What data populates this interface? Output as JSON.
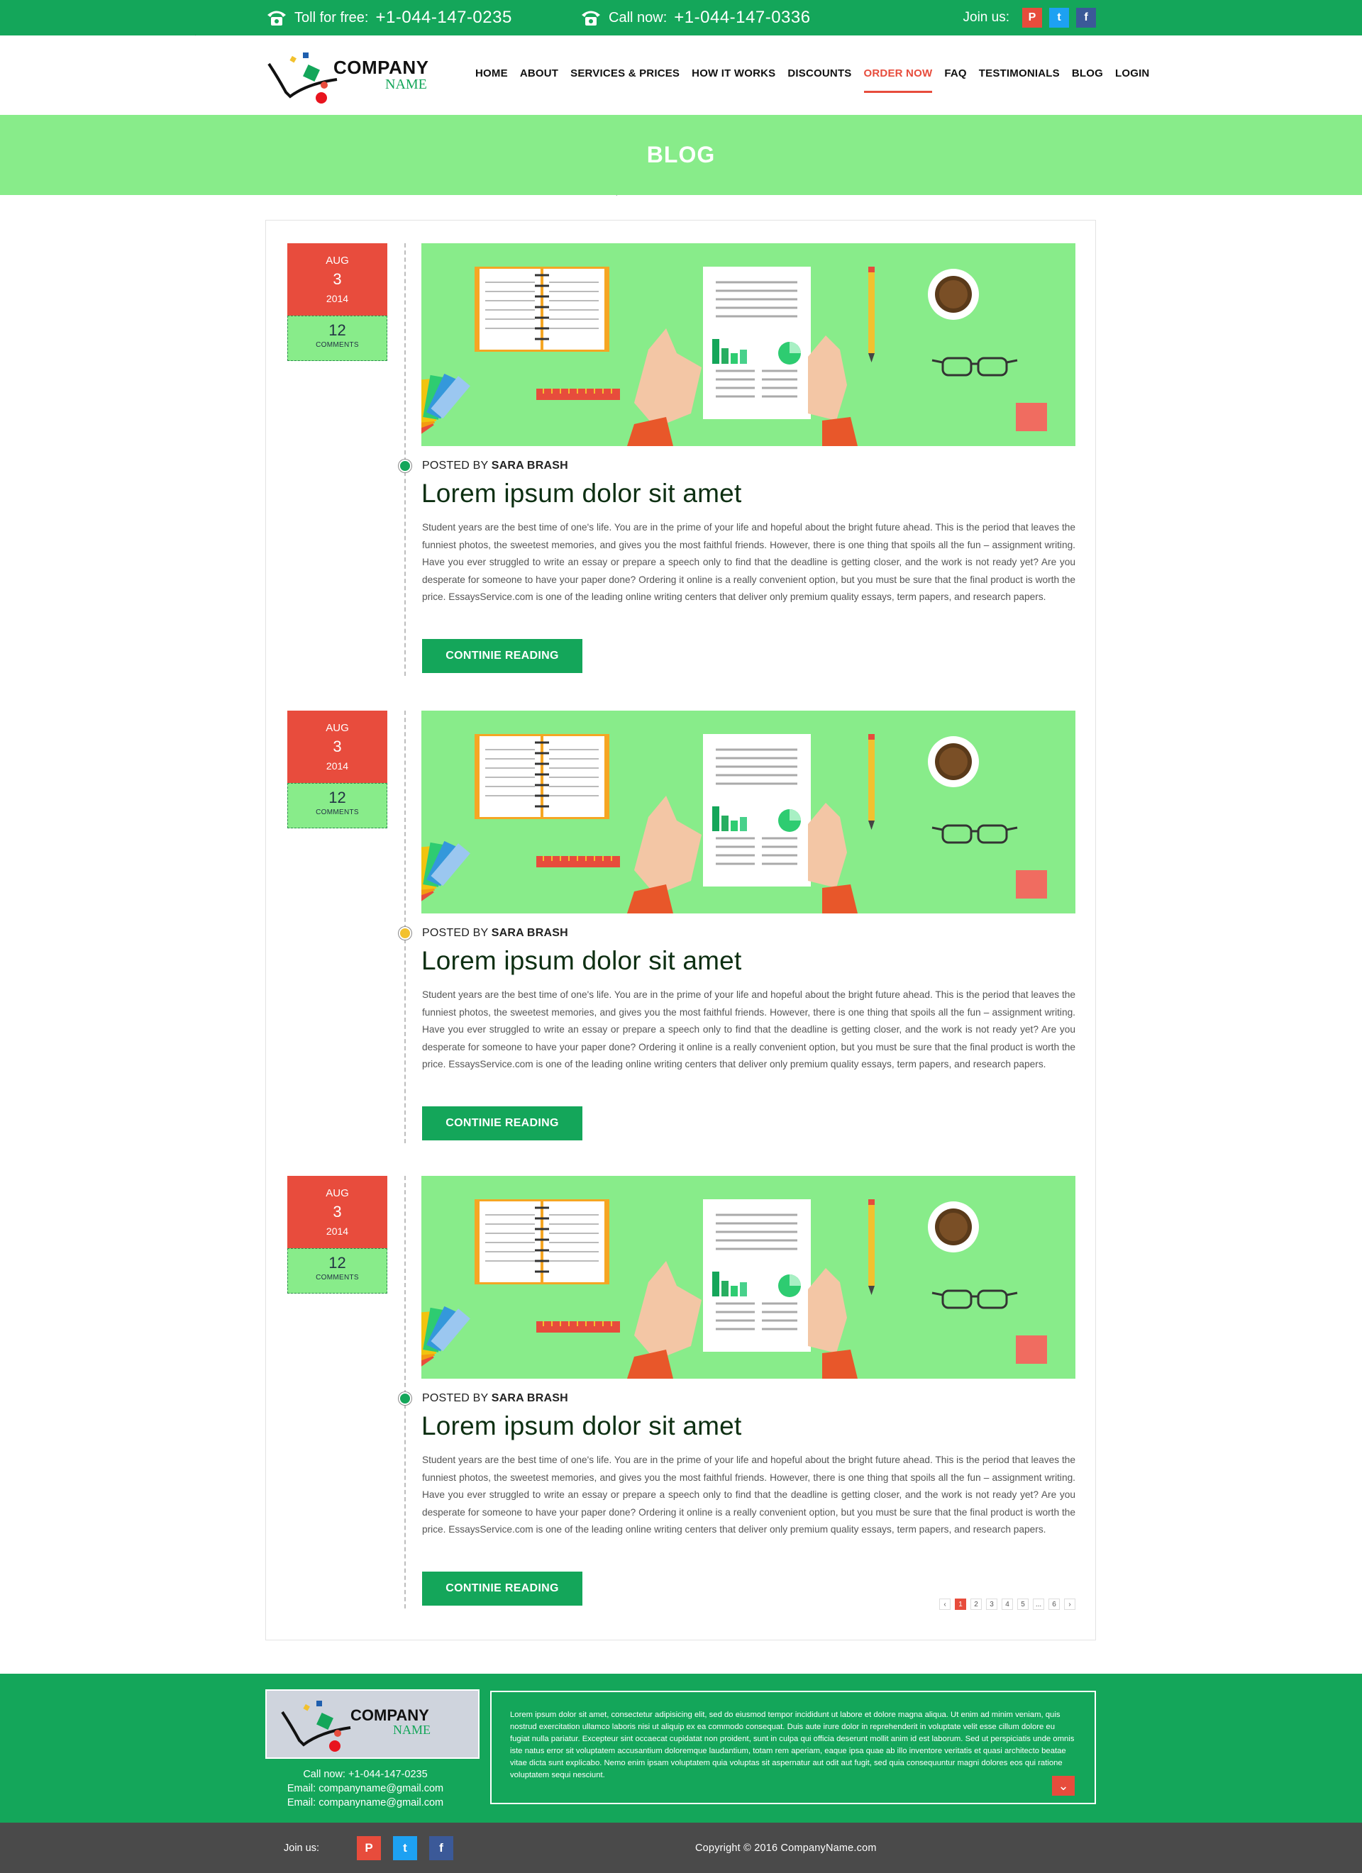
{
  "topbar": {
    "toll_label": "Toll for free:",
    "toll_number": "+1-044-147-0235",
    "call_label": "Call now:",
    "call_number": "+1-044-147-0336",
    "join_label": "Join us:",
    "social": [
      "pinterest-icon",
      "twitter-icon",
      "facebook-icon"
    ]
  },
  "logo": {
    "line1": "COMPANY",
    "line2": "NAME"
  },
  "nav": [
    "HOME",
    "ABOUT",
    "SERVICES & PRICES",
    "HOW IT WORKS",
    "DISCOUNTS",
    "ORDER NOW",
    "FAQ",
    "TESTIMONIALS",
    "BLOG",
    "LOGIN"
  ],
  "nav_active": "ORDER NOW",
  "banner": {
    "title": "BLOG"
  },
  "posts": [
    {
      "month": "AUG",
      "day": "3",
      "year": "2014",
      "comments": "12",
      "comments_label": "COMMENTS",
      "posted_by": "POSTED BY",
      "author": "SARA BRASH",
      "title": "Lorem ipsum dolor sit amet",
      "body": "Student years are the best time of one's life. You are in the prime of your life and hopeful about the bright future ahead. This is the period that leaves the funniest photos, the sweetest memories, and gives you the most faithful friends. However, there is one thing that spoils all the fun – assignment writing. Have you ever struggled to write an essay or prepare a speech only to find that the deadline is getting closer, and the work is not ready yet? Are you desperate for someone to have your paper done? Ordering it online is a really convenient option, but you must be sure that the final product is worth the price. EssaysService.com is one of the leading online writing centers that deliver only premium quality essays, term papers, and research papers.",
      "button": "CONTINIE READING",
      "dot_color": "#14a65a"
    },
    {
      "month": "AUG",
      "day": "3",
      "year": "2014",
      "comments": "12",
      "comments_label": "COMMENTS",
      "posted_by": "POSTED BY",
      "author": "SARA BRASH",
      "title": "Lorem ipsum dolor sit amet",
      "body": "Student years are the best time of one's life. You are in the prime of your life and hopeful about the bright future ahead. This is the period that leaves the funniest photos, the sweetest memories, and gives you the most faithful friends. However, there is one thing that spoils all the fun – assignment writing. Have you ever struggled to write an essay or prepare a speech only to find that the deadline is getting closer, and the work is not ready yet? Are you desperate for someone to have your paper done? Ordering it online is a really convenient option, but you must be sure that the final product is worth the price. EssaysService.com is one of the leading online writing centers that deliver only premium quality essays, term papers, and research papers.",
      "button": "CONTINIE READING",
      "dot_color": "#f2c12e"
    },
    {
      "month": "AUG",
      "day": "3",
      "year": "2014",
      "comments": "12",
      "comments_label": "COMMENTS",
      "posted_by": "POSTED BY",
      "author": "SARA BRASH",
      "title": "Lorem ipsum dolor sit amet",
      "body": "Student years are the best time of one's life. You are in the prime of your life and hopeful about the bright future ahead. This is the period that leaves the funniest photos, the sweetest memories, and gives you the most faithful friends. However, there is one thing that spoils all the fun – assignment writing. Have you ever struggled to write an essay or prepare a speech only to find that the deadline is getting closer, and the work is not ready yet? Are you desperate for someone to have your paper done? Ordering it online is a really convenient option, but you must be sure that the final product is worth the price. EssaysService.com is one of the leading online writing centers that deliver only premium quality essays, term papers, and research papers.",
      "button": "CONTINIE READING",
      "dot_color": "#14a65a"
    }
  ],
  "pagination": {
    "prev": "‹",
    "pages": [
      "1",
      "2",
      "3",
      "4",
      "5",
      "...",
      "6"
    ],
    "current": "1",
    "next": "›"
  },
  "footer": {
    "logo_line1": "COMPANY",
    "logo_line2": "NAME",
    "call": "Call now: +1-044-147-0235",
    "email1": "Email: companyname@gmail.com",
    "email2": "Email: companyname@gmail.com",
    "text": "Lorem ipsum dolor sit amet, consectetur adipisicing elit, sed do eiusmod tempor incididunt ut labore et dolore magna aliqua. Ut enim ad minim veniam, quis nostrud exercitation ullamco laboris nisi ut aliquip ex ea commodo consequat. Duis aute irure dolor in reprehenderit in voluptate velit esse cillum dolore eu fugiat nulla pariatur. Excepteur sint occaecat cupidatat non proident, sunt in culpa qui officia deserunt mollit anim id est laborum. Sed ut perspiciatis unde omnis iste natus error sit voluptatem accusantium doloremque laudantium, totam rem aperiam, eaque ipsa quae ab illo inventore veritatis et quasi architecto beatae vitae dicta sunt explicabo. Nemo enim ipsam voluptatem quia voluptas sit aspernatur aut odit aut fugit, sed quia consequuntur magni dolores eos qui ratione voluptatem sequi nesciunt.",
    "expand_icon": "chevron-down-icon"
  },
  "bottombar": {
    "join_label": "Join us:",
    "copyright": "Copyright © 2016 CompanyName.com"
  },
  "colors": {
    "brand_green": "#14a65a",
    "light_green": "#88ec8a",
    "accent_red": "#e74c3c",
    "dark_bar": "#4a4a4a"
  }
}
